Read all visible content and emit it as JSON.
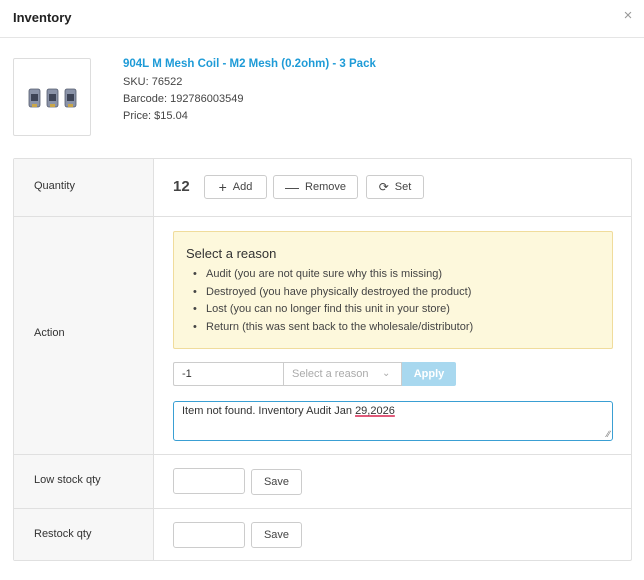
{
  "header": {
    "title": "Inventory",
    "close_glyph": "×"
  },
  "product": {
    "name": "904L M Mesh Coil - M2 Mesh (0.2ohm) - 3 Pack",
    "sku": "SKU: 76522",
    "barcode": "Barcode: 192786003549",
    "price": "Price: $15.04",
    "thumbnail_icon": "coil-pack-icon"
  },
  "quantity": {
    "label": "Quantity",
    "value": "12",
    "add_label": "Add",
    "remove_label": "Remove",
    "set_label": "Set"
  },
  "action": {
    "label": "Action",
    "reason_title": "Select a reason",
    "reasons": [
      "Audit (you are not quite sure why this is missing)",
      "Destroyed (you have physically destroyed the product)",
      "Lost (you can no longer find this unit in your store)",
      "Return (this was sent back to the wholesale/distributor)"
    ],
    "qty_value": "-1",
    "reason_placeholder": "Select a reason",
    "apply_label": "Apply",
    "note_prefix": "Item not found. Inventory Audit Jan ",
    "note_underlined": "29,2026"
  },
  "low_stock": {
    "label": "Low stock qty",
    "save_label": "Save"
  },
  "restock": {
    "label": "Restock qty",
    "save_label": "Save"
  },
  "colors": {
    "link": "#1e9bd7",
    "apply_bg": "#a8d8ef",
    "reason_bg": "#fdf8dc",
    "focus_border": "#3a9fd3"
  }
}
